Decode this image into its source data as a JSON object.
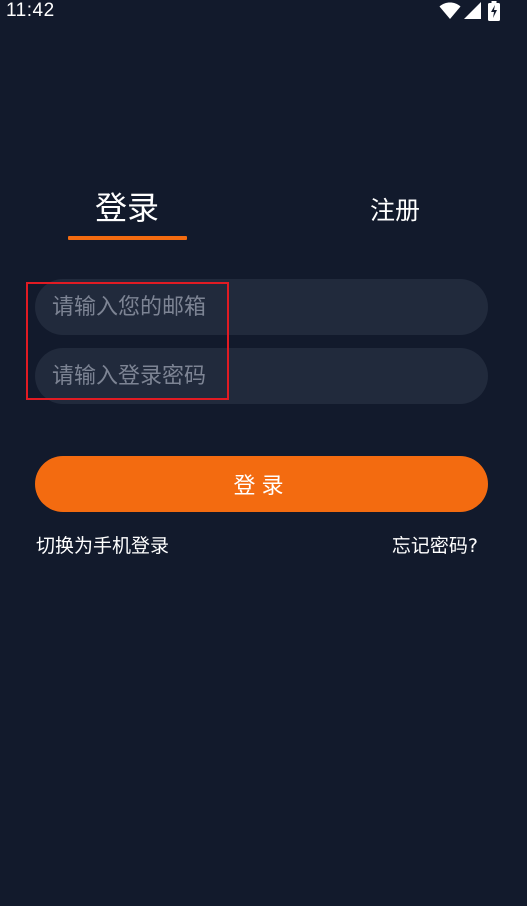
{
  "status_bar": {
    "time": "11:42"
  },
  "tabs": {
    "login": "登录",
    "register": "注册"
  },
  "form": {
    "email_placeholder": "请输入您的邮箱",
    "email_value": "",
    "password_placeholder": "请输入登录密码",
    "password_value": ""
  },
  "actions": {
    "login_button": "登录",
    "switch_phone_login": "切换为手机登录",
    "forgot_password": "忘记密码?"
  },
  "colors": {
    "background": "#121a2c",
    "input_background": "#212a3c",
    "accent": "#f36b10",
    "highlight": "#e11b23"
  },
  "icons": [
    "wifi-icon",
    "cellular-signal-icon",
    "battery-charging-icon"
  ]
}
